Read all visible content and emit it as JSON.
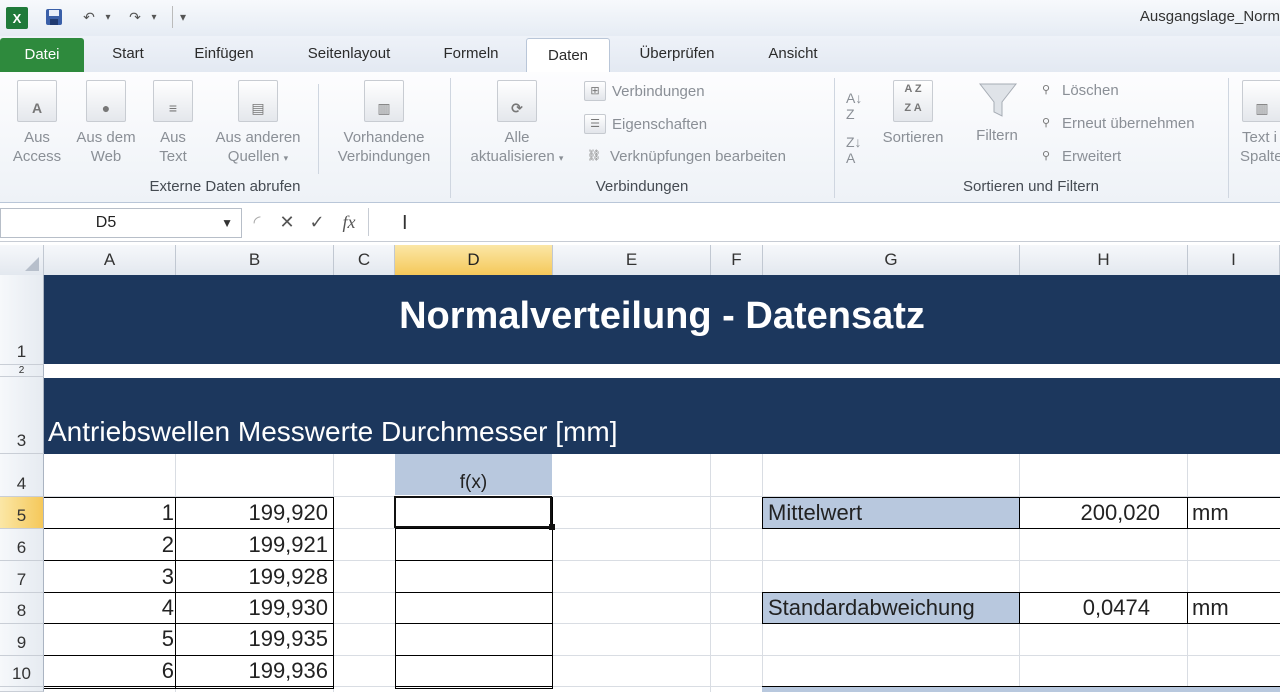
{
  "window": {
    "title": "Ausgangslage_Norm"
  },
  "quick_access": {
    "app_icon": "excel-icon",
    "save_icon": "save-icon",
    "undo_icon": "undo-icon",
    "redo_icon": "redo-icon",
    "customize_icon": "dropdown-icon"
  },
  "tabs": [
    {
      "label": "Datei"
    },
    {
      "label": "Start"
    },
    {
      "label": "Einfügen"
    },
    {
      "label": "Seitenlayout"
    },
    {
      "label": "Formeln"
    },
    {
      "label": "Daten"
    },
    {
      "label": "Überprüfen"
    },
    {
      "label": "Ansicht"
    }
  ],
  "ribbon": {
    "external": {
      "access": {
        "l1": "Aus",
        "l2": "Access"
      },
      "web": {
        "l1": "Aus dem",
        "l2": "Web"
      },
      "text": {
        "l1": "Aus",
        "l2": "Text"
      },
      "other": {
        "l1": "Aus anderen",
        "l2": "Quellen"
      },
      "existing": {
        "l1": "Vorhandene",
        "l2": "Verbindungen"
      },
      "group_label": "Externe Daten abrufen"
    },
    "connections": {
      "refresh": {
        "l1": "Alle",
        "l2": "aktualisieren"
      },
      "connections": "Verbindungen",
      "properties": "Eigenschaften",
      "edit_links": "Verknüpfungen bearbeiten",
      "group_label": "Verbindungen"
    },
    "sort_filter": {
      "sort": "Sortieren",
      "filter": "Filtern",
      "clear": "Löschen",
      "reapply": "Erneut übernehmen",
      "advanced": "Erweitert",
      "group_label": "Sortieren und Filtern"
    },
    "datatools": {
      "l1": "Text i",
      "l2": "Spalte"
    }
  },
  "formula_bar": {
    "name_box": "D5",
    "fx_label": "fx",
    "value": ""
  },
  "columns": [
    "A",
    "B",
    "C",
    "D",
    "E",
    "F",
    "G",
    "H",
    "I"
  ],
  "selected_column": "D",
  "rows": [
    "1",
    "2",
    "3",
    "4",
    "5",
    "6",
    "7",
    "8",
    "9",
    "10"
  ],
  "selected_row": "5",
  "sheet": {
    "title": "Normalverteilung - Datensatz",
    "subtitle": "Antriebswellen Messwerte Durchmesser [mm]",
    "fx_header": "f(x)",
    "data": [
      {
        "n": "1",
        "value": "199,920"
      },
      {
        "n": "2",
        "value": "199,921"
      },
      {
        "n": "3",
        "value": "199,928"
      },
      {
        "n": "4",
        "value": "199,930"
      },
      {
        "n": "5",
        "value": "199,935"
      },
      {
        "n": "6",
        "value": "199,936"
      }
    ],
    "stats": {
      "mean_label": "Mittelwert",
      "mean_value": "200,020",
      "mean_unit": "mm",
      "sd_label": "Standardabweichung",
      "sd_value": "0,0474",
      "sd_unit": "mm"
    }
  },
  "colors": {
    "banner": "#1c375d",
    "header_fill": "#b8c8de",
    "selected_header": "#f5c85a",
    "file_tab": "#2e8a3d"
  }
}
